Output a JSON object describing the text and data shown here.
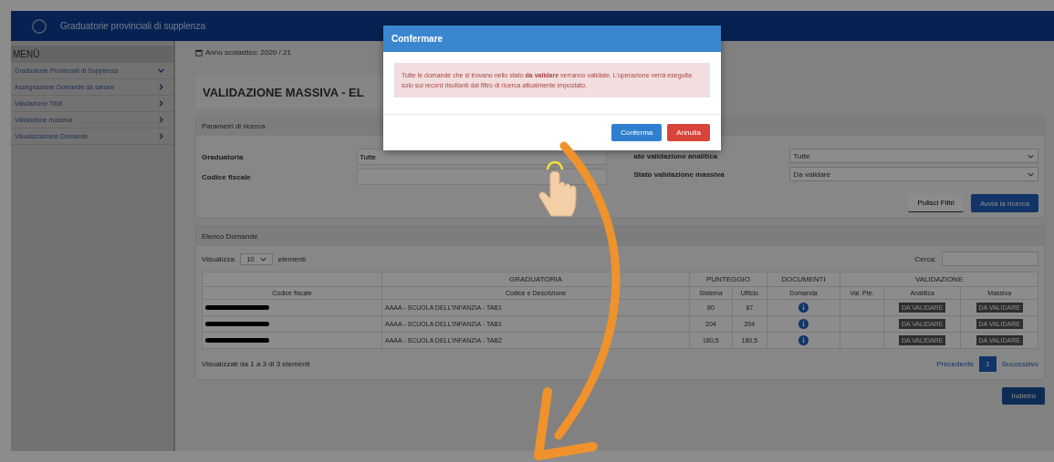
{
  "header": {
    "title": "Graduatorie provinciali di supplenza"
  },
  "sidebar": {
    "heading": "MENÙ",
    "items": [
      {
        "label": "Graduatorie Provinciali di Supplenza",
        "expanded": true
      },
      {
        "label": "Assegnazione Domande da sanare",
        "expanded": false
      },
      {
        "label": "Valutazione Titoli",
        "expanded": false
      },
      {
        "label": "Validazione massiva",
        "expanded": false
      },
      {
        "label": "Visualizzazione Domande",
        "expanded": false
      }
    ]
  },
  "page": {
    "year": "Anno scolastico: 2020 / 21",
    "title": "VALIDAZIONE MASSIVA - EL",
    "search": {
      "heading": "Parametri di ricerca",
      "fields_left": [
        {
          "label": "Graduatoria",
          "value": "Tutte"
        },
        {
          "label": "Codice fiscale"
        }
      ],
      "fields_right": [
        {
          "label": "ato validazione analitica",
          "value": "Tutte"
        },
        {
          "label": "Stato validazione massiva",
          "value": "Da validare"
        }
      ],
      "buttons": [
        {
          "label": "Pulisci Filtri",
          "kind": "link"
        },
        {
          "label": "Avvia la ricerca",
          "kind": "primary"
        }
      ]
    },
    "list": {
      "heading": "Elenco Domande",
      "show_label": "Visualizza",
      "show_value": "10",
      "show_suffix": "elementi",
      "search_label": "Cerca:",
      "groups": [
        "GRADUATORIA",
        "PUNTEGGIO",
        "DOCUMENTI",
        "VALIDAZIONE"
      ],
      "columns": [
        "Codice fiscale",
        "Codice e Descrizione",
        "Sistema",
        "Ufficio",
        "Domanda",
        "Val. Pte.",
        "Analitica",
        "Massiva"
      ],
      "rows": [
        {
          "graduatoria": "AAAA - SCUOLA DELL'INFANZIA - TAB1",
          "sistema": "80",
          "ufficio": "87",
          "analitica": "DA VALIDARE",
          "massiva": "DA VALIDARE"
        },
        {
          "graduatoria": "AAAA - SCUOLA DELL'INFANZIA - TAB1",
          "sistema": "204",
          "ufficio": "204",
          "analitica": "DA VALIDARE",
          "massiva": "DA VALIDARE"
        },
        {
          "graduatoria": "AAAA - SCUOLA DELL'INFANZIA - TAB2",
          "sistema": "180,5",
          "ufficio": "180,5",
          "analitica": "DA VALIDARE",
          "massiva": "DA VALIDARE"
        }
      ],
      "info": "Visualizzati da 1 a 3 di 3 elementi",
      "pagination": {
        "prev": "Precedente",
        "pages": [
          {
            "label": "1",
            "selected": true
          }
        ],
        "next": "Successivo"
      }
    },
    "back": "Indietro"
  },
  "modal": {
    "title": "Confermare",
    "message": "Tutte le domande che si trovano nello stato **da validare** verranno validate. L'operazione verrà eseguita solo sui record risultanti dal filtro di ricerca attualmente impostato.",
    "buttons": [
      {
        "label": "Conferma",
        "kind": "primary"
      },
      {
        "label": "Annulla",
        "kind": "danger"
      }
    ]
  }
}
